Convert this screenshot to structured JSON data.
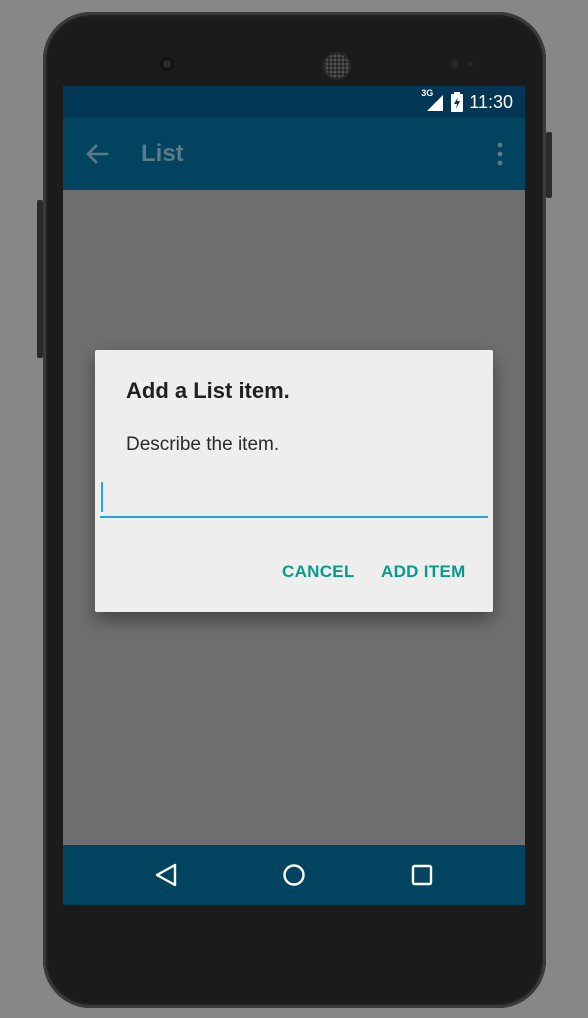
{
  "status_bar": {
    "network": "3G",
    "time": "11:30"
  },
  "app_bar": {
    "title": "List",
    "back_icon": "arrow-back-icon",
    "menu_icon": "more-vert-icon"
  },
  "dialog": {
    "title": "Add a List item.",
    "message": "Describe the item.",
    "input_value": "",
    "cancel_label": "CANCEL",
    "add_label": "ADD ITEM"
  },
  "fab": {
    "icon": "plus-icon"
  },
  "nav_bar": {
    "back_icon": "nav-back-icon",
    "home_icon": "nav-home-icon",
    "recents_icon": "nav-recents-icon"
  },
  "colors": {
    "status_bar": "#013654",
    "app_bar": "#02435f",
    "accent": "#079b8c",
    "input_underline": "#1ea7e1",
    "dialog_bg": "#eeeeee",
    "scrim": "#6f6f6f"
  }
}
